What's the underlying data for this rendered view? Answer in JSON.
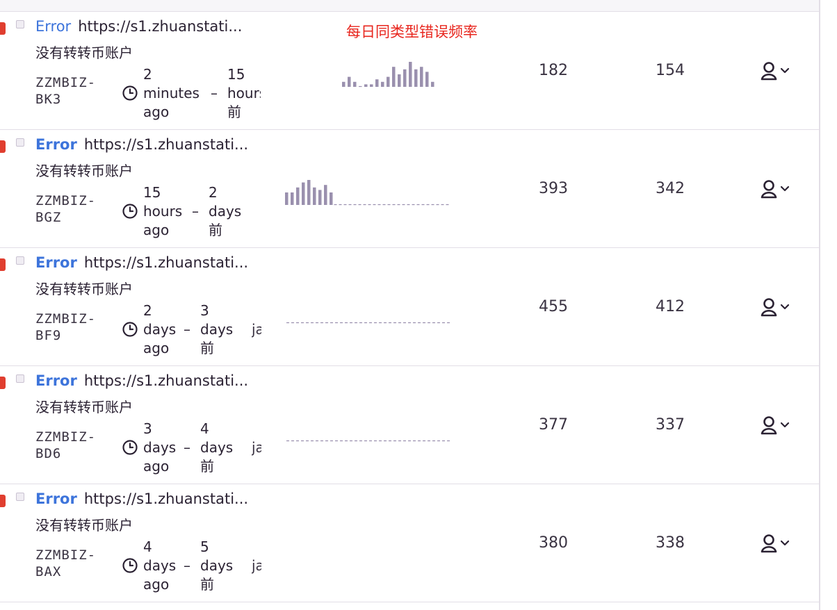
{
  "annotation": "每日同类型错误频率",
  "colors": {
    "error_level": "#e03e2f",
    "error_type": "#3d74db",
    "spark_bar": "#9a90ae",
    "annotation": "#e8261e"
  },
  "icons": {
    "time": "clock-icon",
    "assignee": "user-icon",
    "dropdown": "chevron-down-icon"
  },
  "issues": [
    {
      "type": "Error",
      "url": "https://s1.zhuanstati...",
      "message": "没有转转币账户",
      "short_id": [
        "ZZMBIZ-",
        "BK3"
      ],
      "time_a": [
        "2",
        "minutes",
        "ago"
      ],
      "time_b": [
        "15",
        "hours",
        "前"
      ],
      "trail": "",
      "events": "182",
      "users": "154",
      "chart_data": {
        "type": "bar",
        "values": [
          2,
          4,
          2,
          0,
          1,
          1,
          3,
          2,
          4,
          8,
          5,
          7,
          10,
          7,
          8,
          6,
          2
        ]
      }
    },
    {
      "type": "Error",
      "url": "https://s1.zhuanstati...",
      "message": "没有转转币账户",
      "short_id": [
        "ZZMBIZ-",
        "BGZ"
      ],
      "time_a": [
        "15",
        "hours",
        "ago"
      ],
      "time_b": [
        "2",
        "days",
        "前"
      ],
      "trail": "",
      "events": "393",
      "users": "342",
      "chart_data": {
        "type": "bar",
        "values": [
          5,
          5,
          7,
          9,
          10,
          7,
          6,
          8,
          5,
          0,
          0,
          0,
          0,
          0,
          0,
          0,
          0,
          0,
          0,
          0
        ]
      }
    },
    {
      "type": "Error",
      "url": "https://s1.zhuanstati...",
      "message": "没有转转币账户",
      "short_id": [
        "ZZMBIZ-",
        "BF9"
      ],
      "time_a": [
        "2",
        "days",
        "ago"
      ],
      "time_b": [
        "3",
        "days",
        "前"
      ],
      "trail": "ja",
      "events": "455",
      "users": "412",
      "chart_data": {
        "type": "bar",
        "values": [
          0,
          0,
          0,
          0,
          0,
          0,
          0,
          0,
          0,
          0,
          0,
          0,
          0,
          0,
          0,
          0,
          0,
          0,
          0,
          0
        ]
      }
    },
    {
      "type": "Error",
      "url": "https://s1.zhuanstati...",
      "message": "没有转转币账户",
      "short_id": [
        "ZZMBIZ-",
        "BD6"
      ],
      "time_a": [
        "3",
        "days",
        "ago"
      ],
      "time_b": [
        "4",
        "days",
        "前"
      ],
      "trail": "ja",
      "events": "377",
      "users": "337",
      "chart_data": {
        "type": "bar",
        "values": [
          0,
          0,
          0,
          0,
          0,
          0,
          0,
          0,
          0,
          0,
          0,
          0,
          0,
          0,
          0,
          0,
          0,
          0,
          0,
          0
        ]
      }
    },
    {
      "type": "Error",
      "url": "https://s1.zhuanstati...",
      "message": "没有转转币账户",
      "short_id": [
        "ZZMBIZ-",
        "BAX"
      ],
      "time_a": [
        "4",
        "days",
        "ago"
      ],
      "time_b": [
        "5",
        "days",
        "前"
      ],
      "trail": "ja",
      "events": "380",
      "users": "338",
      "chart_data": {
        "type": "bar",
        "values": []
      }
    }
  ]
}
